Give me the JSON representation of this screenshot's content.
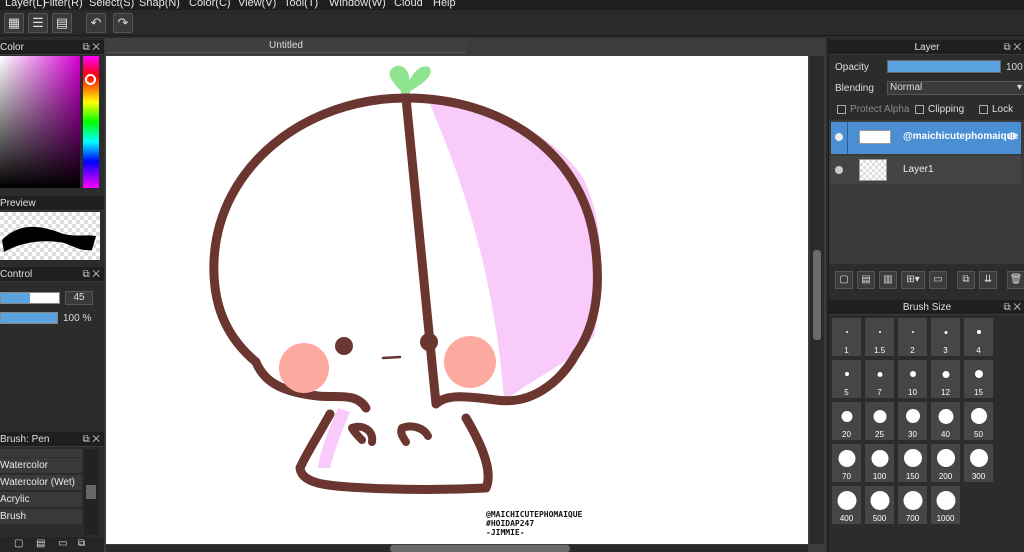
{
  "menubar": {
    "items": [
      "Layer(L)",
      "Filter(R)",
      "Select(S)",
      "Snap(N)",
      "Color(C)",
      "View(V)",
      "Tool(T)",
      "Window(W)",
      "Cloud",
      "Help"
    ]
  },
  "toolbar": {
    "undo_icon": "undo-arrow-icon",
    "redo_icon": "redo-arrow-icon"
  },
  "canvas": {
    "tab_title": "Untitled",
    "watermark": [
      "@MAICHICUTEPHOMAIQUE",
      "#HOIDAP247",
      "-JIMMIE-"
    ]
  },
  "left_panels": {
    "color_title": "Color",
    "preview_title": "Preview",
    "control_title": "Control",
    "control_size_value": "45",
    "control_opacity_value": "100 %",
    "control_size_fraction": 0.5,
    "control_opacity_fraction": 1.0,
    "brush_title": "Brush: Pen",
    "brush_items": [
      "Watercolor",
      "Watercolor (Wet)",
      "Acrylic",
      "Brush"
    ]
  },
  "layer_panel": {
    "title": "Layer",
    "opacity_label": "Opacity",
    "opacity_value": "100",
    "opacity_fraction": 1.0,
    "blending_label": "Blending",
    "blending_value": "Normal",
    "protect_alpha_label": "Protect Alpha",
    "clipping_label": "Clipping",
    "lock_label": "Lock",
    "layers": [
      {
        "name": "@maichicutephomaique",
        "selected": true
      },
      {
        "name": "Layer1",
        "selected": false
      }
    ]
  },
  "brush_size_panel": {
    "title": "Brush Size",
    "sizes": [
      "1",
      "1.5",
      "2",
      "3",
      "4",
      "5",
      "7",
      "10",
      "12",
      "15",
      "20",
      "25",
      "30",
      "40",
      "50",
      "70",
      "100",
      "150",
      "200",
      "300",
      "400",
      "500",
      "700",
      "1000"
    ]
  },
  "colors": {
    "selection_blue": "#4a8fd4",
    "slider_blue": "#5aa3e0",
    "outline_brown": "#6b3530",
    "blush_pink": "#fcaaa0",
    "shadow_lavender": "#f9cbfb",
    "sprout_green": "#8ee48f"
  }
}
